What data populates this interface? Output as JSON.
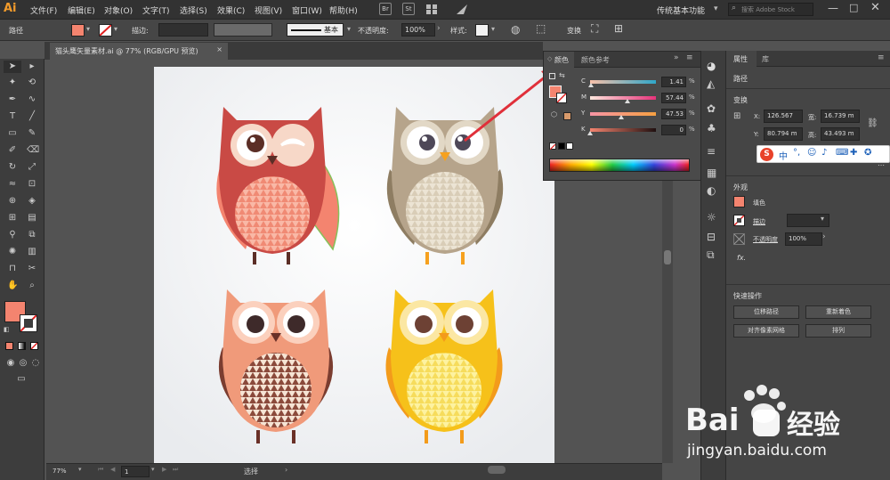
{
  "app": {
    "logo": "Ai",
    "workspace": "传统基本功能",
    "search_placeholder": "搜索 Adobe Stock"
  },
  "menus": [
    "文件(F)",
    "编辑(E)",
    "对象(O)",
    "文字(T)",
    "选择(S)",
    "效果(C)",
    "视图(V)",
    "窗口(W)",
    "帮助(H)"
  ],
  "toolbar_icons": {
    "br": "Br",
    "st": "St"
  },
  "control": {
    "object_type": "路径",
    "stroke_label": "描边:",
    "stroke_style": "基本",
    "opacity_label": "不透明度:",
    "opacity_value": "100%",
    "style_label": "样式:",
    "transform_label": "变换",
    "fill_color": "#f4846f"
  },
  "document": {
    "tab_title": "猫头鹰矢量素材.ai @ 77% (RGB/GPU 预览)",
    "close": "×"
  },
  "color_panel": {
    "tab_active": "颜色",
    "tab_inactive": "颜色参考",
    "channels": [
      {
        "label": "C",
        "value": "1.41",
        "unit": "%",
        "level": 0.014
      },
      {
        "label": "M",
        "value": "57.44",
        "unit": "%",
        "level": 0.574
      },
      {
        "label": "Y",
        "value": "47.53",
        "unit": "%",
        "level": 0.475
      },
      {
        "label": "K",
        "value": "0",
        "unit": "%",
        "level": 0
      }
    ]
  },
  "properties": {
    "tab_active": "属性",
    "tab_inactive": "库",
    "selection_type": "路径",
    "transform_title": "变换",
    "x_label": "X:",
    "x_value": "126.567",
    "y_label": "Y:",
    "y_value": "80.794 m",
    "w_label": "宽:",
    "w_value": "16.739 m",
    "h_label": "高:",
    "h_value": "43.493 m",
    "appearance_title": "外观",
    "fill_label": "填色",
    "stroke_label": "描边",
    "opacity_label": "不透明度",
    "opacity_value": "100%",
    "fx_label": "fx.",
    "quick_actions_title": "快速操作",
    "btn_offset_path": "位移路径",
    "btn_recolor": "重新着色",
    "btn_align_pixel": "对齐像素网格",
    "btn_arrange": "排列"
  },
  "status": {
    "zoom": "77%",
    "page": "1",
    "tool": "选择"
  },
  "ime_bar": {
    "text": "中"
  },
  "watermark": {
    "brand_latin": "Bai",
    "brand_cn": "经验",
    "url": "jingyan.baidu.com"
  },
  "colors": {
    "owl_red": "#c94a45",
    "owl_taupe": "#b6a48b",
    "owl_peach": "#f09a7a",
    "owl_yellow": "#f6c11a",
    "accent_fill": "#f4846f"
  }
}
